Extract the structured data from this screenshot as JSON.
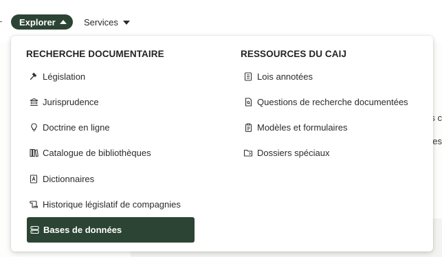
{
  "nav": {
    "explorer_label": "Explorer",
    "services_label": "Services"
  },
  "background": {
    "frag1": "s c",
    "frag2": "es"
  },
  "left_column": {
    "title": "RECHERCHE DOCUMENTAIRE",
    "items": [
      {
        "label": "Législation",
        "icon": "gavel-icon"
      },
      {
        "label": "Jurisprudence",
        "icon": "courthouse-icon"
      },
      {
        "label": "Doctrine en ligne",
        "icon": "lightbulb-icon"
      },
      {
        "label": "Catalogue de bibliothèques",
        "icon": "books-icon"
      },
      {
        "label": "Dictionnaires",
        "icon": "dictionary-icon"
      },
      {
        "label": "Historique législatif de compagnies",
        "icon": "scroll-icon"
      },
      {
        "label": "Bases de données",
        "icon": "database-icon",
        "active": true
      }
    ]
  },
  "right_column": {
    "title": "RESSOURCES DU CAIJ",
    "items": [
      {
        "label": "Lois annotées",
        "icon": "annotated-law-icon"
      },
      {
        "label": "Questions de recherche documentées",
        "icon": "document-search-icon"
      },
      {
        "label": "Modèles et formulaires",
        "icon": "clipboard-icon"
      },
      {
        "label": "Dossiers spéciaux",
        "icon": "folder-icon"
      }
    ]
  },
  "colors": {
    "accent": "#2c4434",
    "text": "#2a2a2a"
  }
}
